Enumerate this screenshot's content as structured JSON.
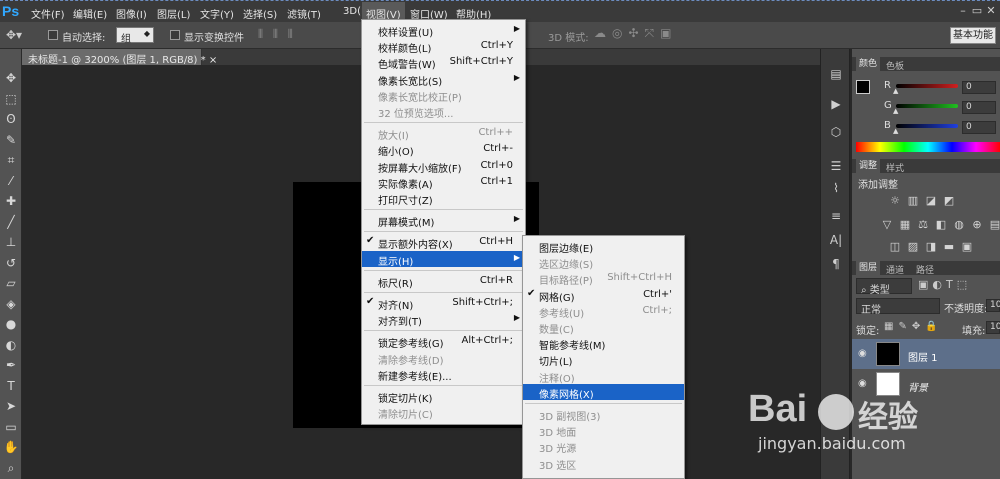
{
  "app": {
    "logo": "Ps"
  },
  "menubar": {
    "items": [
      "文件(F)",
      "编辑(E)",
      "图像(I)",
      "图层(L)",
      "文字(Y)",
      "选择(S)",
      "滤镜(T)",
      "3D(D)",
      "视图(V)",
      "窗口(W)",
      "帮助(H)"
    ]
  },
  "window_controls": [
    "–",
    "▭",
    "✕"
  ],
  "options": {
    "auto_select": "自动选择:",
    "group_value": "组",
    "show_transform": "显示变换控件",
    "mode_3d": "3D 模式:",
    "workspace": "基本功能"
  },
  "document": {
    "tab": "未标题-1 @ 3200% (图层 1, RGB/8) *"
  },
  "view_menu": [
    {
      "label": "校样设置(U)",
      "arrow": true
    },
    {
      "label": "校样颜色(L)",
      "shortcut": "Ctrl+Y"
    },
    {
      "label": "色域警告(W)",
      "shortcut": "Shift+Ctrl+Y"
    },
    {
      "label": "像素长宽比(S)",
      "arrow": true
    },
    {
      "label": "像素长宽比校正(P)",
      "disabled": true
    },
    {
      "label": "32 位预览选项...",
      "disabled": true
    },
    {
      "sep": true
    },
    {
      "label": "放大(I)",
      "shortcut": "Ctrl++",
      "disabled": true
    },
    {
      "label": "缩小(O)",
      "shortcut": "Ctrl+-"
    },
    {
      "label": "按屏幕大小缩放(F)",
      "shortcut": "Ctrl+0"
    },
    {
      "label": "实际像素(A)",
      "shortcut": "Ctrl+1"
    },
    {
      "label": "打印尺寸(Z)"
    },
    {
      "sep": true
    },
    {
      "label": "屏幕模式(M)",
      "arrow": true
    },
    {
      "sep": true
    },
    {
      "label": "显示额外内容(X)",
      "shortcut": "Ctrl+H",
      "checked": true
    },
    {
      "label": "显示(H)",
      "arrow": true,
      "highlighted": true
    },
    {
      "sep": true
    },
    {
      "label": "标尺(R)",
      "shortcut": "Ctrl+R"
    },
    {
      "sep": true
    },
    {
      "label": "对齐(N)",
      "shortcut": "Shift+Ctrl+;",
      "checked": true
    },
    {
      "label": "对齐到(T)",
      "arrow": true
    },
    {
      "sep": true
    },
    {
      "label": "锁定参考线(G)",
      "shortcut": "Alt+Ctrl+;"
    },
    {
      "label": "清除参考线(D)",
      "disabled": true
    },
    {
      "label": "新建参考线(E)..."
    },
    {
      "sep": true
    },
    {
      "label": "锁定切片(K)"
    },
    {
      "label": "清除切片(C)",
      "disabled": true
    }
  ],
  "show_submenu": [
    {
      "label": "图层边缘(E)"
    },
    {
      "label": "选区边缘(S)",
      "disabled": true
    },
    {
      "label": "目标路径(P)",
      "shortcut": "Shift+Ctrl+H",
      "disabled": true
    },
    {
      "label": "网格(G)",
      "shortcut": "Ctrl+'",
      "checked": true
    },
    {
      "label": "参考线(U)",
      "shortcut": "Ctrl+;",
      "disabled": true
    },
    {
      "label": "数量(C)",
      "disabled": true
    },
    {
      "label": "智能参考线(M)"
    },
    {
      "label": "切片(L)"
    },
    {
      "label": "注释(O)",
      "disabled": true
    },
    {
      "label": "像素网格(X)",
      "highlighted": true
    },
    {
      "sep": true
    },
    {
      "label": "3D 副视图(3)",
      "disabled": true
    },
    {
      "label": "3D 地面",
      "disabled": true
    },
    {
      "label": "3D 光源",
      "disabled": true
    },
    {
      "label": "3D 选区",
      "disabled": true
    }
  ],
  "color_panel": {
    "tabs": [
      "颜色",
      "色板"
    ],
    "channels": [
      {
        "name": "R",
        "value": "0",
        "color": "#d02020"
      },
      {
        "name": "G",
        "value": "0",
        "color": "#20c020"
      },
      {
        "name": "B",
        "value": "0",
        "color": "#2040e0"
      }
    ]
  },
  "adjust_panel": {
    "tabs": [
      "调整",
      "样式"
    ],
    "title": "添加调整"
  },
  "layers_panel": {
    "tabs": [
      "图层",
      "通道",
      "路径"
    ],
    "filter": "类型",
    "blend": "正常",
    "opacity_label": "不透明度:",
    "opacity_value": "10",
    "lock_label": "锁定:",
    "fill_label": "填充:",
    "fill_value": "10",
    "layers": [
      {
        "name": "图层 1",
        "selected": true
      },
      {
        "name": "背景",
        "italic": true
      }
    ]
  },
  "watermark": {
    "brand": "Bai",
    "brand2": "经验",
    "url": "jingyan.baidu.com"
  }
}
